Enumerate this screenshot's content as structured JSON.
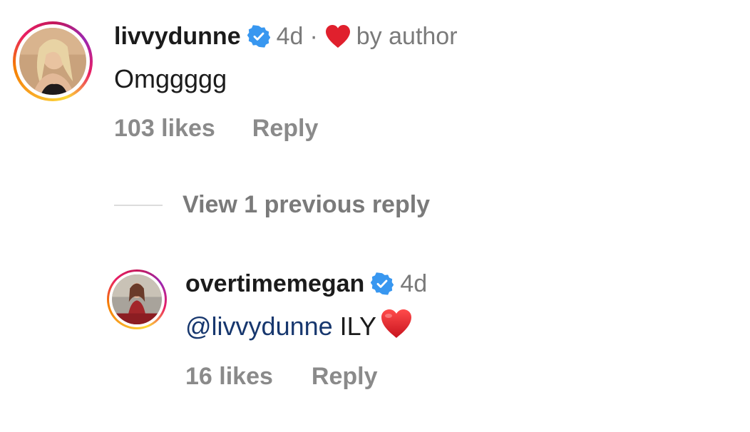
{
  "comments": [
    {
      "username": "livvydunne",
      "verified": true,
      "time": "4d",
      "separator": "·",
      "liked_by_author_label": "by author",
      "text": "Omggggg",
      "likes": "103 likes",
      "reply_label": "Reply"
    }
  ],
  "thread": {
    "view_replies_label": "View 1 previous reply"
  },
  "replies": [
    {
      "username": "overtimemegan",
      "verified": true,
      "time": "4d",
      "mention": "@livvydunne",
      "text": "ILY",
      "likes": "16 likes",
      "reply_label": "Reply"
    }
  ],
  "colors": {
    "verified_blue": "#3897f0",
    "heart_red": "#e0202d",
    "mention_blue": "#17376e",
    "muted_gray": "#7a7a7a"
  }
}
